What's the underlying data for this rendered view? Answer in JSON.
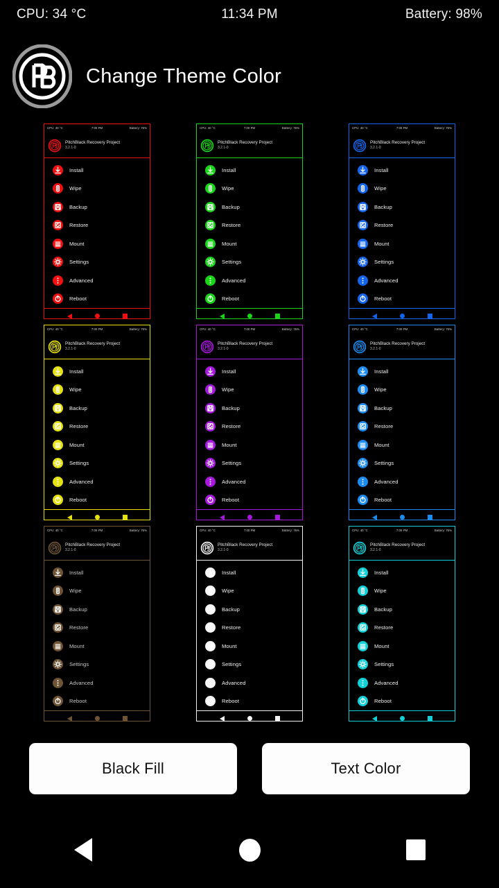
{
  "status_bar": {
    "cpu": "CPU: 34 °C",
    "time": "11:34 PM",
    "battery": "Battery: 98%"
  },
  "header": {
    "title": "Change Theme Color",
    "logo_icon": "pitchblack-pb-logo-icon"
  },
  "preview_common": {
    "app_name": "PitchBlack Recovery Project",
    "version": "3.2.1-0",
    "logo_icon": "pb-logo-icon",
    "status": {
      "cpu": "CPU: 40 °C",
      "time": "7:00 PM",
      "battery": "Battery: 76%"
    },
    "menu": [
      {
        "label": "Install",
        "icon": "install-download-icon"
      },
      {
        "label": "Wipe",
        "icon": "wipe-eraser-icon"
      },
      {
        "label": "Backup",
        "icon": "backup-save-icon"
      },
      {
        "label": "Restore",
        "icon": "restore-box-icon"
      },
      {
        "label": "Mount",
        "icon": "mount-list-icon"
      },
      {
        "label": "Settings",
        "icon": "settings-gear-icon"
      },
      {
        "label": "Advanced",
        "icon": "advanced-dots-icon"
      },
      {
        "label": "Reboot",
        "icon": "reboot-power-icon"
      }
    ],
    "nav": {
      "back_icon": "nav-back-triangle-icon",
      "home_icon": "nav-home-circle-icon",
      "recents_icon": "nav-recents-square-icon"
    }
  },
  "themes": [
    {
      "name": "red",
      "color": "#f01010",
      "text": "#f2f2f2",
      "row": 0,
      "col": 0
    },
    {
      "name": "green",
      "color": "#19d619",
      "text": "#f2f2f2",
      "row": 0,
      "col": 1
    },
    {
      "name": "blue",
      "color": "#1565ec",
      "text": "#f2f2f2",
      "row": 0,
      "col": 2
    },
    {
      "name": "yellow",
      "color": "#e6e210",
      "text": "#f2f2f2",
      "row": 1,
      "col": 0
    },
    {
      "name": "purple",
      "color": "#a618dc",
      "text": "#f2f2f2",
      "row": 1,
      "col": 1
    },
    {
      "name": "light-blue",
      "color": "#1d8cf0",
      "text": "#f2f2f2",
      "row": 1,
      "col": 2
    },
    {
      "name": "bronze",
      "color": "#6e5434",
      "text": "#c9c9c9",
      "row": 2,
      "col": 0
    },
    {
      "name": "white",
      "color": "#f5f5f5",
      "text": "#f2f2f2",
      "row": 2,
      "col": 1
    },
    {
      "name": "cyan",
      "color": "#12cfd8",
      "text": "#f2f2f2",
      "row": 2,
      "col": 2
    }
  ],
  "actions": {
    "black_fill": "Black Fill",
    "text_color": "Text Color"
  },
  "system_nav": {
    "back_icon": "system-back-icon",
    "home_icon": "system-home-icon",
    "recents_icon": "system-recents-icon"
  }
}
